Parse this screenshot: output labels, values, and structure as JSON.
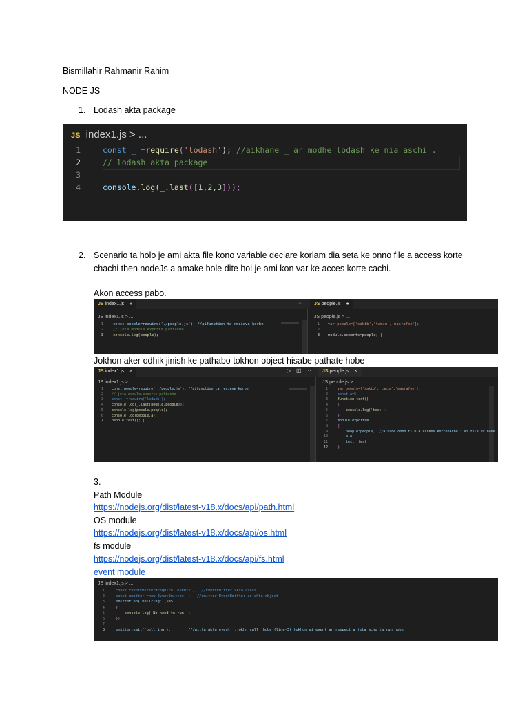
{
  "doc": {
    "heading": "Bismillahir Rahmanir Rahim",
    "topic": "NODE JS",
    "item1_number": "1.",
    "item1_text": "Lodash  akta package",
    "item2_number": "2.",
    "item2_line1": "Scenario ta holo je ami akta file kono variable declare korlam dia seta ke onno file a access korte",
    "item2_line2": "chachi then nodeJs a amake bole dite hoi je ami kon var ke acces korte  cachi.",
    "item2_access": "Akon access pabo.",
    "item2_object": "Jokhon aker odhik jinish ke pathabo tokhon object hisabe pathate hobe",
    "item3_number": "3.",
    "path_label": "Path Module",
    "path_url": "https://nodejs.org/dist/latest-v18.x/docs/api/path.html",
    "os_label": "OS module",
    "os_url": "https://nodejs.org/dist/latest-v18.x/docs/api/os.html",
    "fs_label": "fs module",
    "fs_url": "https://nodejs.org/dist/latest-v18.x/docs/api/fs.html",
    "event_label": "event module"
  },
  "shot1": {
    "badge": "JS",
    "crumb": "index1.js > ...",
    "line_numbers": [
      "1",
      "2",
      "3",
      "4"
    ],
    "line1_a": "const _ ",
    "line1_b": "=require",
    "line1_c": "(",
    "line1_d": "'lodash'",
    "line1_e": "); ",
    "line1_f": "//aikhane _ ar modhe lodash ke nia aschi .",
    "line2": "// lodash akta package",
    "line4_a": "console",
    "line4_b": ".",
    "line4_c": "log",
    "line4_d": "(_.",
    "line4_e": "last",
    "line4_f": "([",
    "line4_g": "1,2,3",
    "line4_h": "]));"
  },
  "shot2": {
    "left_tab": "index1.js",
    "left_tab_mark": "●",
    "left_more": "···",
    "right_tab": "people.js",
    "right_tab_mark": "●",
    "left_crumb": "JS index1.js > ...",
    "right_crumb": "JS people.js > ...",
    "left_lines": [
      "const people=require('./people.js'); //aifunction ta recieve korbe",
      "// jeta module.exports patiache",
      "console.log(people);"
    ],
    "right_lines": [
      "var people=['sakib','tamim','masrafee'];",
      "",
      "module.exports=people; |"
    ]
  },
  "shot3": {
    "left_tab": "index1.js",
    "left_tab_mark": "×",
    "right_tab": "people.js",
    "right_tab_mark": "×",
    "left_crumb": "JS index1.js > ...",
    "right_crumb": "JS people.js > ...",
    "left_lines": [
      "const people=require('./people.js'); //aifunction ta recieve korbe",
      "// jeta module.exports patiache",
      "const _=require('lodash');",
      "console.log(_.last(people.people));",
      "console.log(people.people);",
      "console.log(people.a);",
      "people.test(); |"
    ],
    "right_lines": [
      "var people=['sakib','tamim','masrafee'];",
      "const a=6;",
      "function test()",
      "{",
      "    console.log('test');",
      "}",
      "module.exports=",
      "{",
      "    people:people,  //aikane onno file a access korteparbo : ai file er name",
      "    a:a,",
      "    test: test",
      "}"
    ]
  },
  "shot4": {
    "crumb": "JS index1.js > ...",
    "lines": [
      "const EventEmitter=require('events');  //EventEmitter akta class",
      "const emitter =new EventEmitter();   //emitter EventEmitter ar akta object",
      "emitter.on('bellring',()=>",
      "{",
      "    console.log('No need to run');",
      "})",
      "",
      "emitter.emit('bellring');        ///aitta akta event  .jokhn call  hobe (line-3) tokhon ai event ar respect a jeta ache ta run hobe"
    ]
  }
}
